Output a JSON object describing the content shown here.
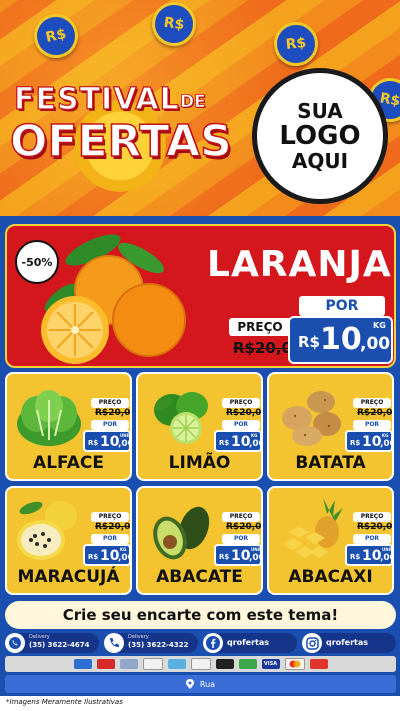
{
  "colors": {
    "brand_blue": "#1a4fb0",
    "feature_red": "#d4161d",
    "card_yellow": "#f3c430",
    "hero_orange": "#f28a1c"
  },
  "hero": {
    "coin_text": "R$",
    "title_line1": "FESTIVAL",
    "title_de": "DE",
    "title_line2": "OFERTAS",
    "logo": {
      "line1": "SUA",
      "line2": "LOGO",
      "line3": "AQUI"
    }
  },
  "featured": {
    "discount": "-50%",
    "name": "LARANJA",
    "preco_label": "PREÇO",
    "old_price": "R$20,00",
    "por_label": "POR",
    "currency": "R$",
    "price_int": "10",
    "price_cents": ",00",
    "unit": "KG"
  },
  "products": [
    {
      "name": "ALFACE",
      "preco_label": "PREÇO",
      "old_price": "R$20,00",
      "por_label": "POR",
      "currency": "R$",
      "price_int": "10",
      "price_cents": ",00",
      "unit": "UNID",
      "icon": "lettuce-icon"
    },
    {
      "name": "LIMÃO",
      "preco_label": "PREÇO",
      "old_price": "R$20,00",
      "por_label": "POR",
      "currency": "R$",
      "price_int": "10",
      "price_cents": ",00",
      "unit": "KG",
      "icon": "lime-icon"
    },
    {
      "name": "BATATA",
      "preco_label": "PREÇO",
      "old_price": "R$20,00",
      "por_label": "POR",
      "currency": "R$",
      "price_int": "10",
      "price_cents": ",00",
      "unit": "KG",
      "icon": "potato-icon"
    },
    {
      "name": "MARACUJÁ",
      "preco_label": "PREÇO",
      "old_price": "R$20,00",
      "por_label": "POR",
      "currency": "R$",
      "price_int": "10",
      "price_cents": ",00",
      "unit": "KG",
      "icon": "passionfruit-icon"
    },
    {
      "name": "ABACATE",
      "preco_label": "PREÇO",
      "old_price": "R$20,00",
      "por_label": "POR",
      "currency": "R$",
      "price_int": "10",
      "price_cents": ",00",
      "unit": "UNID",
      "icon": "avocado-icon"
    },
    {
      "name": "ABACAXI",
      "preco_label": "PREÇO",
      "old_price": "R$20,00",
      "por_label": "POR",
      "currency": "R$",
      "price_int": "10",
      "price_cents": ",00",
      "unit": "UNID",
      "icon": "pineapple-icon"
    }
  ],
  "cta": "Crie seu encarte com este tema!",
  "contacts": {
    "whatsapp": {
      "label": "Delivery",
      "value": "(35) 3622-4674",
      "icon": "whatsapp-icon"
    },
    "phone": {
      "label": "Delivery",
      "value": "(35) 3622-4322",
      "icon": "phone-icon"
    },
    "facebook": {
      "value": "qrofertas",
      "icon": "facebook-icon"
    },
    "instagram": {
      "value": "qrofertas",
      "icon": "instagram-icon"
    }
  },
  "payments": [
    "card-icon",
    "card-icon",
    "card-icon",
    "card-icon",
    "card-icon",
    "card-icon",
    "card-icon",
    "card-icon",
    "visa-icon",
    "mastercard-icon",
    "card-icon"
  ],
  "payment_visa": "VISA",
  "address": {
    "icon": "location-pin-icon",
    "text": "Rua"
  },
  "footer": "*Imagens Meramente Ilustrativas"
}
